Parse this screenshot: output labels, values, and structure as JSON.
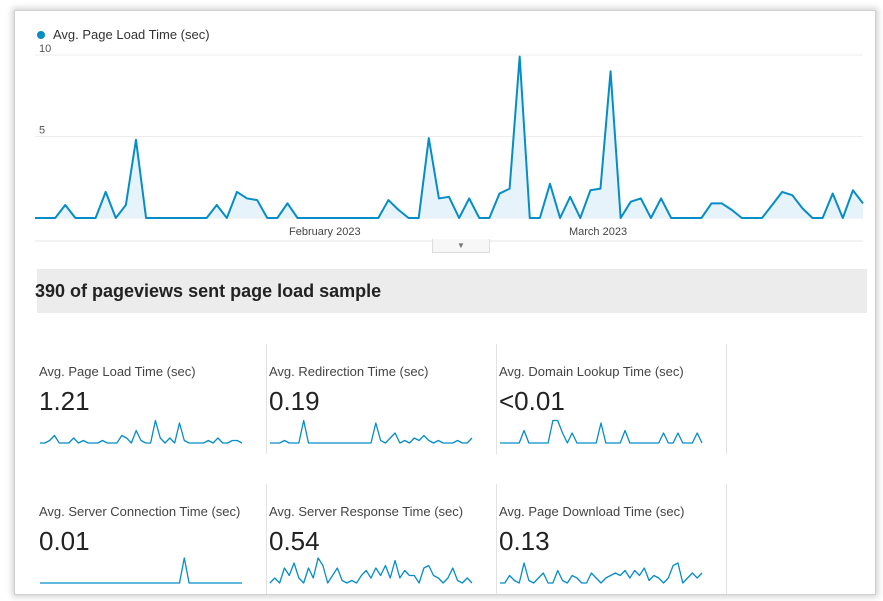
{
  "chart_data": [
    {
      "type": "area",
      "series": [
        {
          "name": "Avg. Page Load Time (sec)",
          "color": "#058dc7",
          "values": [
            0,
            0,
            0,
            0.8,
            0,
            0,
            0,
            1.6,
            0,
            0.8,
            4.8,
            0,
            0,
            0,
            0,
            0,
            0,
            0,
            0.8,
            0,
            1.6,
            1.2,
            1.1,
            0,
            0,
            0.9,
            0,
            0,
            0,
            0,
            0,
            0,
            0,
            0,
            0,
            1.1,
            0.5,
            0,
            0,
            4.9,
            1.2,
            1.3,
            0,
            1.2,
            0,
            0,
            1.5,
            1.8,
            9.9,
            0,
            0,
            2.1,
            0,
            1.3,
            0,
            1.7,
            1.8,
            9.0,
            0,
            1.0,
            1.2,
            0,
            1.2,
            0,
            0,
            0,
            0,
            0.9,
            0.9,
            0.5,
            0,
            0,
            0,
            0.8,
            1.6,
            1.4,
            0.6,
            0,
            0,
            1.5,
            0,
            1.7,
            0.9
          ]
        }
      ],
      "xlabels": [
        "February 2023",
        "March 2023"
      ],
      "yticks": [
        "10",
        "5"
      ],
      "ylim": [
        0,
        10
      ],
      "legend": "top-left",
      "grid": true
    },
    {
      "type": "line",
      "title": "Avg. Page Load Time (sec)",
      "values": [
        0,
        0,
        0.1,
        0.3,
        0,
        0,
        0,
        0.2,
        0,
        0.1,
        0,
        0,
        0,
        0.1,
        0,
        0,
        0,
        0.3,
        0.2,
        0,
        0.5,
        0.1,
        0,
        0,
        0.9,
        0.2,
        0,
        0.2,
        0,
        0.8,
        0.1,
        0,
        0,
        0,
        0,
        0.1,
        0,
        0.2,
        0,
        0,
        0.1,
        0.1,
        0
      ]
    },
    {
      "type": "line",
      "title": "Avg. Redirection Time (sec)",
      "values": [
        0,
        0,
        0,
        0.1,
        0,
        0,
        0,
        0.9,
        0,
        0,
        0,
        0,
        0,
        0,
        0,
        0,
        0,
        0,
        0,
        0,
        0,
        0,
        0.8,
        0.1,
        0,
        0.2,
        0.4,
        0,
        0.1,
        0,
        0.2,
        0.1,
        0.3,
        0.1,
        0,
        0.1,
        0,
        0,
        0,
        0.1,
        0,
        0,
        0.2
      ]
    },
    {
      "type": "line",
      "title": "Avg. Domain Lookup Time (sec)",
      "values": [
        0,
        0,
        0,
        0,
        0,
        0.5,
        0,
        0,
        0,
        0,
        0,
        0.9,
        0.9,
        0.4,
        0,
        0.4,
        0,
        0,
        0,
        0,
        0,
        0.8,
        0,
        0,
        0,
        0,
        0.5,
        0,
        0,
        0,
        0,
        0,
        0,
        0,
        0.4,
        0,
        0,
        0.4,
        0,
        0,
        0,
        0.4,
        0
      ]
    },
    {
      "type": "line",
      "title": "Avg. Server Connection Time (sec)",
      "values": [
        0,
        0,
        0,
        0,
        0,
        0,
        0,
        0,
        0,
        0,
        0,
        0,
        0,
        0,
        0,
        0,
        0,
        0,
        0,
        0,
        0,
        0,
        0,
        0,
        0,
        0,
        0,
        0,
        0,
        0,
        1.0,
        0,
        0,
        0,
        0,
        0,
        0,
        0,
        0,
        0,
        0,
        0,
        0
      ]
    },
    {
      "type": "line",
      "title": "Avg. Server Response Time (sec)",
      "values": [
        0,
        0.2,
        0,
        0.6,
        0.3,
        0.8,
        0.2,
        0,
        0.6,
        0.2,
        1.0,
        0.7,
        0,
        0.3,
        0.6,
        0.1,
        0,
        0.1,
        0,
        0.3,
        0.5,
        0.2,
        0.6,
        0.3,
        0.7,
        0.2,
        0.9,
        0.2,
        0.5,
        0.3,
        0.3,
        0,
        0.6,
        0.7,
        0.3,
        0.2,
        0,
        0.2,
        0.6,
        0.1,
        0,
        0.2,
        0
      ]
    },
    {
      "type": "line",
      "title": "Avg. Page Download Time (sec)",
      "values": [
        0,
        0,
        0.3,
        0.1,
        0,
        0.8,
        0.1,
        0,
        0.2,
        0.4,
        0,
        0,
        0.5,
        0.1,
        0,
        0.3,
        0.2,
        0,
        0,
        0.4,
        0.2,
        0,
        0.2,
        0.3,
        0.4,
        0.3,
        0.5,
        0.2,
        0.5,
        0.3,
        0.6,
        0.1,
        0.3,
        0.2,
        0,
        0.2,
        0.7,
        0.8,
        0,
        0.2,
        0.4,
        0.2,
        0.4
      ]
    }
  ],
  "header": {
    "legend_label": "Avg. Page Load Time (sec)",
    "collapse_glyph": "▼"
  },
  "summary": {
    "text": "390 of pageviews sent page load sample"
  },
  "metrics": [
    {
      "label": "Avg. Page Load Time (sec)",
      "value": "1.21"
    },
    {
      "label": "Avg. Redirection Time (sec)",
      "value": "0.19"
    },
    {
      "label": "Avg. Domain Lookup Time (sec)",
      "value": "<0.01"
    },
    {
      "label": "Avg. Server Connection Time (sec)",
      "value": "0.01"
    },
    {
      "label": "Avg. Server Response Time (sec)",
      "value": "0.54"
    },
    {
      "label": "Avg. Page Download Time (sec)",
      "value": "0.13"
    }
  ],
  "colors": {
    "line": "#058dc7",
    "fill": "#e7f3fa",
    "grid": "#ececec",
    "summary_bg": "#ececec"
  }
}
